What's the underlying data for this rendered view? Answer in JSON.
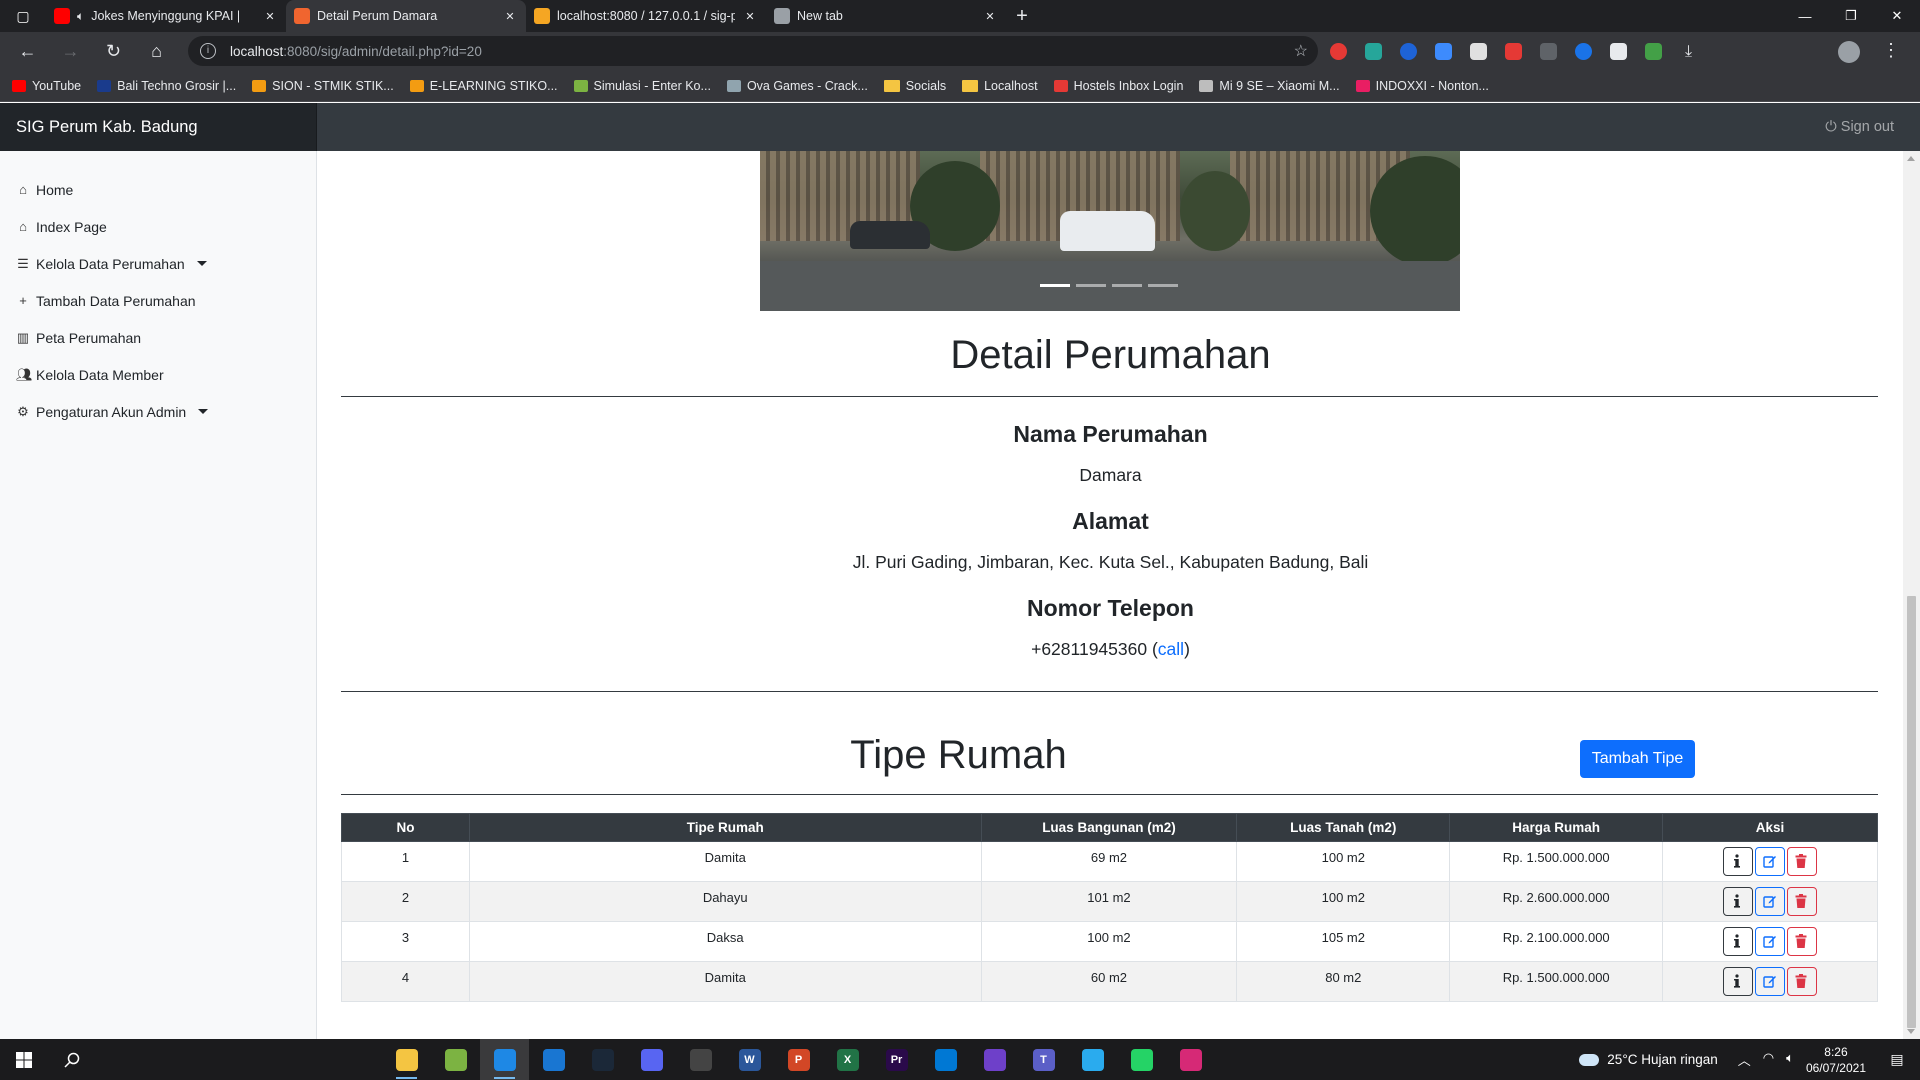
{
  "browser": {
    "tabs": [
      {
        "title": "Jokes Menyinggung KPAI |",
        "favicon_color": "#ff0000",
        "active": false
      },
      {
        "title": "Detail Perum Damara",
        "favicon_color": "#f0652f",
        "active": true
      },
      {
        "title": "localhost:8080 / 127.0.0.1 / sig-p",
        "favicon_color": "#f5a623",
        "active": false
      },
      {
        "title": "New tab",
        "favicon_color": "#9aa0a6",
        "active": false
      }
    ],
    "url_host": "localhost",
    "url_path": ":8080/sig/admin/detail.php?id=20",
    "bookmarks": [
      {
        "label": "YouTube",
        "icon_color": "#ff0000"
      },
      {
        "label": "Bali Techno Grosir |...",
        "icon_color": "#1a3b8c"
      },
      {
        "label": "SION - STMIK STIK...",
        "icon_color": "#f39c12"
      },
      {
        "label": "E-LEARNING STIKO...",
        "icon_color": "#f39c12"
      },
      {
        "label": "Simulasi - Enter Ko...",
        "icon_color": "#7cb342"
      },
      {
        "label": "Ova Games - Crack...",
        "icon_color": "#90a4ae"
      },
      {
        "label": "Socials",
        "icon": "folder-icon"
      },
      {
        "label": "Localhost",
        "icon": "folder-icon"
      },
      {
        "label": "Hostels Inbox Login",
        "icon_color": "#e53935"
      },
      {
        "label": "Mi 9 SE – Xiaomi M...",
        "icon_color": "#bdbdbd"
      },
      {
        "label": "INDOXXI - Nonton...",
        "icon_color": "#e91e63"
      }
    ]
  },
  "app": {
    "brand": "SIG Perum Kab. Badung",
    "signout": "Sign out",
    "sidebar": [
      {
        "label": "Home",
        "icon": "home-icon",
        "caret": false
      },
      {
        "label": "Index Page",
        "icon": "home-icon",
        "caret": false
      },
      {
        "label": "Kelola Data Perumahan",
        "icon": "list-icon",
        "caret": true
      },
      {
        "label": "Tambah Data Perumahan",
        "icon": "plus-icon",
        "caret": false
      },
      {
        "label": "Peta Perumahan",
        "icon": "map-icon",
        "caret": false
      },
      {
        "label": "Kelola Data Member",
        "icon": "users-icon",
        "caret": false
      },
      {
        "label": "Pengaturan Akun Admin",
        "icon": "gear-icon",
        "caret": true
      }
    ]
  },
  "detail": {
    "heading": "Detail Perumahan",
    "nama_label": "Nama Perumahan",
    "nama_value": "Damara",
    "alamat_label": "Alamat",
    "alamat_value": "Jl. Puri Gading, Jimbaran, Kec. Kuta Sel., Kabupaten Badung, Bali",
    "telepon_label": "Nomor Telepon",
    "telepon_value": "+62811945360",
    "call_link": "call"
  },
  "tipe": {
    "heading": "Tipe Rumah",
    "add_button": "Tambah Tipe",
    "columns": [
      "No",
      "Tipe Rumah",
      "Luas Bangunan (m2)",
      "Luas Tanah (m2)",
      "Harga Rumah",
      "Aksi"
    ],
    "rows": [
      {
        "no": "1",
        "tipe": "Damita",
        "bangunan": "69 m2",
        "tanah": "100 m2",
        "harga": "Rp. 1.500.000.000"
      },
      {
        "no": "2",
        "tipe": "Dahayu",
        "bangunan": "101 m2",
        "tanah": "100 m2",
        "harga": "Rp. 2.600.000.000"
      },
      {
        "no": "3",
        "tipe": "Daksa",
        "bangunan": "100 m2",
        "tanah": "105 m2",
        "harga": "Rp. 2.100.000.000"
      },
      {
        "no": "4",
        "tipe": "Damita",
        "bangunan": "60 m2",
        "tanah": "80 m2",
        "harga": "Rp. 1.500.000.000"
      }
    ]
  },
  "taskbar": {
    "apps": [
      {
        "name": "file-explorer-icon",
        "color": "#f4c542",
        "glyph": "",
        "running": true
      },
      {
        "name": "notepad-icon",
        "color": "#7cb342",
        "glyph": "",
        "running": false
      },
      {
        "name": "edge-icon",
        "color": "#1e88e5",
        "glyph": "",
        "running": true,
        "active": true
      },
      {
        "name": "mail-icon",
        "color": "#1976d2",
        "glyph": "",
        "running": false
      },
      {
        "name": "steam-icon",
        "color": "#1b2838",
        "glyph": "",
        "running": false
      },
      {
        "name": "discord-icon",
        "color": "#5865f2",
        "glyph": "",
        "running": false
      },
      {
        "name": "obs-icon",
        "color": "#444444",
        "glyph": "",
        "running": false
      },
      {
        "name": "word-icon",
        "color": "#2b579a",
        "glyph": "W",
        "running": false
      },
      {
        "name": "powerpoint-icon",
        "color": "#d24726",
        "glyph": "P",
        "running": false
      },
      {
        "name": "excel-icon",
        "color": "#217346",
        "glyph": "X",
        "running": false
      },
      {
        "name": "premiere-icon",
        "color": "#2a0a4a",
        "glyph": "Pr",
        "running": false
      },
      {
        "name": "vscode-icon",
        "color": "#0078d4",
        "glyph": "",
        "running": false
      },
      {
        "name": "github-icon",
        "color": "#6e40c9",
        "glyph": "",
        "running": false
      },
      {
        "name": "teams-icon",
        "color": "#5b5fc7",
        "glyph": "T",
        "running": false
      },
      {
        "name": "telegram-icon",
        "color": "#2aabee",
        "glyph": "",
        "running": false
      },
      {
        "name": "whatsapp-icon",
        "color": "#25d366",
        "glyph": "",
        "running": false
      },
      {
        "name": "instagram-icon",
        "color": "#d62976",
        "glyph": "",
        "running": false
      }
    ],
    "weather": "25°C  Hujan ringan",
    "time": "8:26",
    "date": "06/07/2021"
  }
}
